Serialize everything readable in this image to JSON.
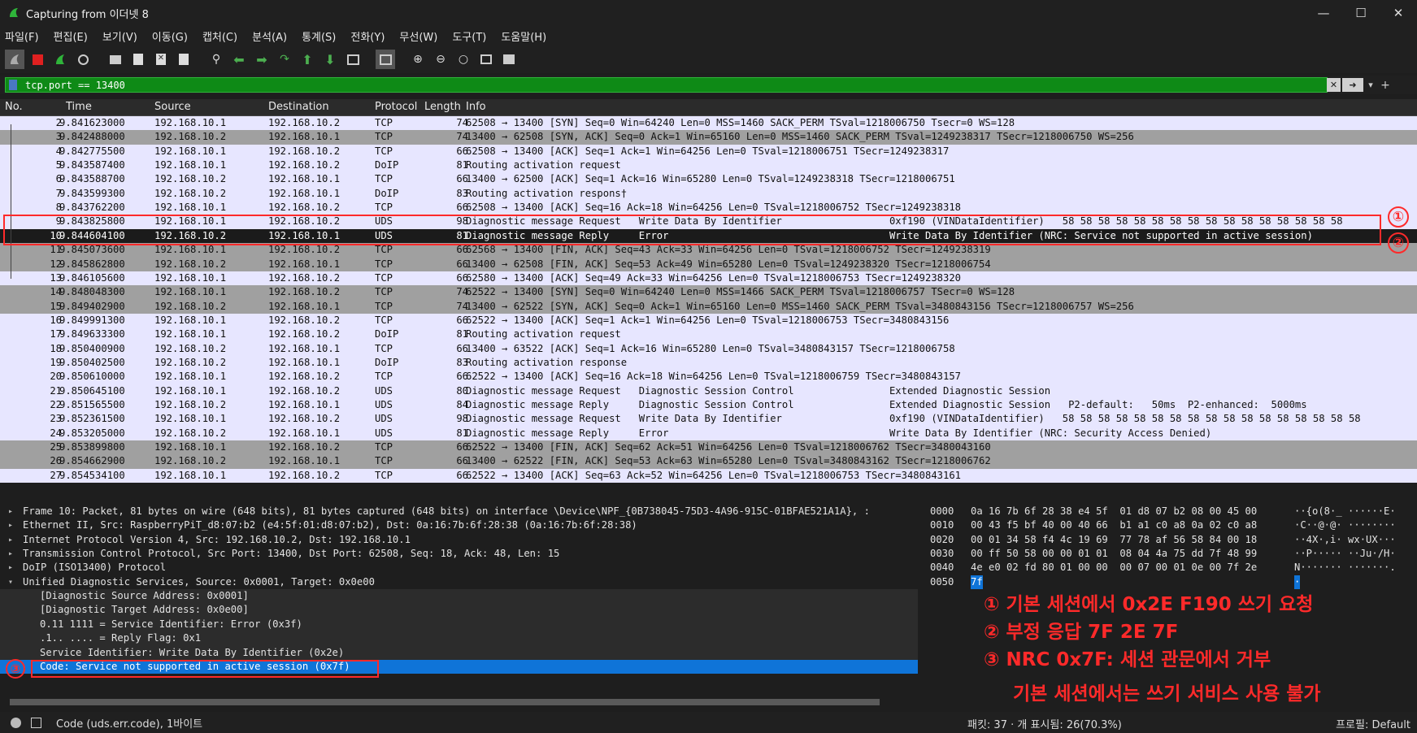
{
  "window": {
    "title": "Capturing from 이더넷 8"
  },
  "menu": [
    "파일(F)",
    "편집(E)",
    "보기(V)",
    "이동(G)",
    "캡처(C)",
    "분석(A)",
    "통계(S)",
    "전화(Y)",
    "무선(W)",
    "도구(T)",
    "도움말(H)"
  ],
  "filter": {
    "value": "tcp.port == 13400"
  },
  "columns": [
    "No.",
    "Time",
    "Source",
    "Destination",
    "Protocol",
    "Length",
    "Info"
  ],
  "packets": [
    {
      "no": "2",
      "time": "9.841623000",
      "src": "192.168.10.1",
      "dst": "192.168.10.2",
      "proto": "TCP",
      "len": "74",
      "info": "62508 → 13400 [SYN] Seq=0 Win=64240 Len=0 MSS=1460 SACK_PERM TSval=1218006750 Tsecr=0 WS=128",
      "style": "tcp-light"
    },
    {
      "no": "3",
      "time": "9.842488000",
      "src": "192.168.10.2",
      "dst": "192.168.10.1",
      "proto": "TCP",
      "len": "74",
      "info": "13400 → 62508 [SYN, ACK] Seq=0 Ack=1 Win=65160 Len=0 MSS=1460 SACK_PERM TSval=1249238317 TSecr=1218006750 WS=256",
      "style": "tcp-gray"
    },
    {
      "no": "4",
      "time": "9.842775500",
      "src": "192.168.10.1",
      "dst": "192.168.10.2",
      "proto": "TCP",
      "len": "66",
      "info": "62508 → 13400 [ACK] Seq=1 Ack=1 Win=64256 Len=0 TSval=1218006751 TSecr=1249238317",
      "style": "tcp-light"
    },
    {
      "no": "5",
      "time": "9.843587400",
      "src": "192.168.10.1",
      "dst": "192.168.10.2",
      "proto": "DoIP",
      "len": "81",
      "info": "Routing activation request",
      "style": "tcp-light"
    },
    {
      "no": "6",
      "time": "9.843588700",
      "src": "192.168.10.2",
      "dst": "192.168.10.1",
      "proto": "TCP",
      "len": "66",
      "info": "13400 → 62500 [ACK] Seq=1 Ack=16 Win=65280 Len=0 TSval=1249238318 TSecr=1218006751",
      "style": "tcp-light"
    },
    {
      "no": "7",
      "time": "9.843599300",
      "src": "192.168.10.2",
      "dst": "192.168.10.1",
      "proto": "DoIP",
      "len": "83",
      "info": "Routing activation respons†",
      "style": "tcp-light"
    },
    {
      "no": "8",
      "time": "9.843762200",
      "src": "192.168.10.1",
      "dst": "192.168.10.2",
      "proto": "TCP",
      "len": "66",
      "info": "62508 → 13400 [ACK] Seq=16 Ack=18 Win=64256 Len=0 TSval=1218006752 TSecr=1249238318",
      "style": "tcp-light"
    },
    {
      "no": "9",
      "time": "9.843825800",
      "src": "192.168.10.1",
      "dst": "192.168.10.2",
      "proto": "UDS",
      "len": "98",
      "info": "Diagnostic message Request   Write Data By Identifier                  0xf190 (VINDataIdentifier)   58 58 58 58 58 58 58 58 58 58 58 58 58 58 58 58",
      "style": "tcp-light"
    },
    {
      "no": "10",
      "time": "9.844604100",
      "src": "192.168.10.2",
      "dst": "192.168.10.1",
      "proto": "UDS",
      "len": "81",
      "info": "Diagnostic message Reply     Error                                     Write Data By Identifier (NRC: Service not supported in active session)",
      "style": "sel"
    },
    {
      "no": "11",
      "time": "9.845073600",
      "src": "192.168.10.1",
      "dst": "192.168.10.2",
      "proto": "TCP",
      "len": "66",
      "info": "62568 → 13400 [FIN, ACK] Seq=43 Ack=33 Win=64256 Len=0 TSval=1218006752 TSecr=1249238319",
      "style": "tcp-gray"
    },
    {
      "no": "12",
      "time": "9.845862800",
      "src": "192.168.10.2",
      "dst": "192.168.10.1",
      "proto": "TCP",
      "len": "66",
      "info": "13400 → 62508 [FIN, ACK] Seq=53 Ack=49 Win=65280 Len=0 TSval=1249238320 TSecr=1218006754",
      "style": "tcp-gray"
    },
    {
      "no": "13",
      "time": "9.846105600",
      "src": "192.168.10.1",
      "dst": "192.168.10.2",
      "proto": "TCP",
      "len": "66",
      "info": "62580 → 13400 [ACK] Seq=49 Ack=33 Win=64256 Len=0 TSval=1218006753 TSecr=1249238320",
      "style": "tcp-light"
    },
    {
      "no": "14",
      "time": "9.848048300",
      "src": "192.168.10.1",
      "dst": "192.168.10.2",
      "proto": "TCP",
      "len": "74",
      "info": "62522 → 13400 [SYN] Seq=0 Win=64240 Len=0 MSS=1466 SACK_PERM TSval=1218006757 TSecr=0 WS=128",
      "style": "tcp-gray"
    },
    {
      "no": "15",
      "time": "9.849402900",
      "src": "192.168.10.2",
      "dst": "192.168.10.1",
      "proto": "TCP",
      "len": "74",
      "info": "13400 → 62522 [SYN, ACK] Seq=0 Ack=1 Win=65160 Len=0 MSS=1460 SACK_PERM TSval=3480843156 TSecr=1218006757 WS=256",
      "style": "tcp-gray"
    },
    {
      "no": "16",
      "time": "9.849991300",
      "src": "192.168.10.1",
      "dst": "192.168.10.2",
      "proto": "TCP",
      "len": "66",
      "info": "62522 → 13400 [ACK] Seq=1 Ack=1 Win=64256 Len=0 TSval=1218006753 TSecr=3480843156",
      "style": "tcp-light"
    },
    {
      "no": "17",
      "time": "9.849633300",
      "src": "192.168.10.1",
      "dst": "192.168.10.2",
      "proto": "DoIP",
      "len": "81",
      "info": "Routing activation request",
      "style": "tcp-light"
    },
    {
      "no": "18",
      "time": "9.850400900",
      "src": "192.168.10.2",
      "dst": "192.168.10.1",
      "proto": "TCP",
      "len": "66",
      "info": "13400 → 63522 [ACK] Seq=1 Ack=16 Win=65280 Len=0 TSval=3480843157 TSecr=1218006758",
      "style": "tcp-light"
    },
    {
      "no": "19",
      "time": "9.850402500",
      "src": "192.168.10.2",
      "dst": "192.168.10.1",
      "proto": "DoIP",
      "len": "83",
      "info": "Routing activation response",
      "style": "tcp-light"
    },
    {
      "no": "20",
      "time": "9.850610000",
      "src": "192.168.10.1",
      "dst": "192.168.10.2",
      "proto": "TCP",
      "len": "66",
      "info": "62522 → 13400 [ACK] Seq=16 Ack=18 Win=64256 Len=0 TSval=1218006759 TSecr=3480843157",
      "style": "tcp-light"
    },
    {
      "no": "21",
      "time": "9.850645100",
      "src": "192.168.10.1",
      "dst": "192.168.10.2",
      "proto": "UDS",
      "len": "80",
      "info": "Diagnostic message Request   Diagnostic Session Control                Extended Diagnostic Session",
      "style": "tcp-light"
    },
    {
      "no": "22",
      "time": "9.851565500",
      "src": "192.168.10.2",
      "dst": "192.168.10.1",
      "proto": "UDS",
      "len": "84",
      "info": "Diagnostic message Reply     Diagnostic Session Control                Extended Diagnostic Session   P2-default:   50ms  P2-enhanced:  5000ms",
      "style": "tcp-light"
    },
    {
      "no": "23",
      "time": "9.852361500",
      "src": "192.168.10.1",
      "dst": "192.168.10.2",
      "proto": "UDS",
      "len": "98",
      "info": "Diagnostic message Request   Write Data By Identifier                  0xf190 (VINDataIdentifier)   58 58 58 58 58 58 58 58 58 58 58 58 58 58 58 58 58",
      "style": "tcp-light"
    },
    {
      "no": "24",
      "time": "9.853205000",
      "src": "192.168.10.2",
      "dst": "192.168.10.1",
      "proto": "UDS",
      "len": "81",
      "info": "Diagnostic message Reply     Error                                     Write Data By Identifier (NRC: Security Access Denied)",
      "style": "tcp-light"
    },
    {
      "no": "25",
      "time": "9.853899800",
      "src": "192.168.10.1",
      "dst": "192.168.10.2",
      "proto": "TCP",
      "len": "66",
      "info": "62522 → 13400 [FIN, ACK] Seq=62 Ack=51 Win=64256 Len=0 TSval=1218006762 TSecr=3480043160",
      "style": "tcp-gray"
    },
    {
      "no": "26",
      "time": "9.854662900",
      "src": "192.168.10.2",
      "dst": "192.168.10.1",
      "proto": "TCP",
      "len": "66",
      "info": "13400 → 62522 [FIN, ACK] Seq=53 Ack=63 Win=65280 Len=0 TSval=3480843162 TSecr=1218006762",
      "style": "tcp-gray"
    },
    {
      "no": "27",
      "time": "9.854534100",
      "src": "192.168.10.1",
      "dst": "192.168.10.2",
      "proto": "TCP",
      "len": "66",
      "info": "62522 → 13400 [ACK] Seq=63 Ack=52 Win=64256 Len=0 TSval=1218006753 TSecr=3480843161",
      "style": "tcp-light"
    }
  ],
  "details": [
    {
      "text": "Frame 10: Packet, 81 bytes on wire (648 bits), 81 bytes captured (648 bits) on interface \\Device\\NPF_{0B738045-75D3-4A96-915C-01BFAE521A1A}, :",
      "indent": 0,
      "arrow": "▸",
      "style": ""
    },
    {
      "text": "Ethernet II, Src: RaspberryPiT_d8:07:b2 (e4:5f:01:d8:07:b2), Dst: 0a:16:7b:6f:28:38 (0a:16:7b:6f:28:38)",
      "indent": 0,
      "arrow": "▸",
      "style": ""
    },
    {
      "text": "Internet Protocol Version 4, Src: 192.168.10.2, Dst: 192.168.10.1",
      "indent": 0,
      "arrow": "▸",
      "style": ""
    },
    {
      "text": "Transmission Control Protocol, Src Port: 13400, Dst Port: 62508, Seq: 18, Ack: 48, Len: 15",
      "indent": 0,
      "arrow": "▸",
      "style": ""
    },
    {
      "text": "DoIP (ISO13400) Protocol",
      "indent": 0,
      "arrow": "▸",
      "style": ""
    },
    {
      "text": "Unified Diagnostic Services, Source: 0x0001, Target: 0x0e00",
      "indent": 0,
      "arrow": "▾",
      "style": ""
    },
    {
      "text": "[Diagnostic Source Address: 0x0001]",
      "indent": 1,
      "arrow": "",
      "style": "sub"
    },
    {
      "text": "[Diagnostic Target Address: 0x0e00]",
      "indent": 1,
      "arrow": "",
      "style": "sub"
    },
    {
      "text": "0.11 1111 = Service Identifier: Error (0x3f)",
      "indent": 1,
      "arrow": "",
      "style": "sub"
    },
    {
      "text": ".1.. .... = Reply Flag: 0x1",
      "indent": 1,
      "arrow": "",
      "style": "sub"
    },
    {
      "text": "Service Identifier: Write Data By Identifier (0x2e)",
      "indent": 1,
      "arrow": "",
      "style": "sub"
    },
    {
      "text": "Code: Service not supported in active session (0x7f)",
      "indent": 1,
      "arrow": "",
      "style": "sel"
    }
  ],
  "hex": [
    {
      "off": "0000",
      "bytes": "0a 16 7b 6f 28 38 e4 5f  01 d8 07 b2 08 00 45 00",
      "ascii": "··{o(8·_ ······E·"
    },
    {
      "off": "0010",
      "bytes": "00 43 f5 bf 40 00 40 66  b1 a1 c0 a8 0a 02 c0 a8",
      "ascii": "·C··@·@· ········"
    },
    {
      "off": "0020",
      "bytes": "00 01 34 58 f4 4c 19 69  77 78 af 56 58 84 00 18",
      "ascii": "··4X·,i· wx·UX···"
    },
    {
      "off": "0030",
      "bytes": "00 ff 50 58 00 00 01 01  08 04 4a 75 dd 7f 48 99",
      "ascii": "··P····· ··Ju·/H·"
    },
    {
      "off": "0040",
      "bytes": "4e e0 02 fd 80 01 00 00  00 07 00 01 0e 00 7f 2e",
      "ascii": "N······· ·······."
    },
    {
      "off": "0050",
      "bytes": "7f",
      "ascii": "·"
    }
  ],
  "annotations": {
    "n1": "①",
    "n2": "②",
    "n3": "③",
    "lines": [
      "①  기본 세션에서 0x2E F190 쓰기 요청",
      "②  부정 응답 7F 2E 7F",
      "③  NRC 0x7F: 세션 관문에서 거부",
      "기본 세션에서는 쓰기 서비스 사용 불가"
    ]
  },
  "status": {
    "field": "Code (uds.err.code), 1바이트",
    "packets": "패킷: 37 · 개 표시됨: 26(70.3%)",
    "profile": "프로필: Default"
  },
  "colors": {
    "accent": "#0f74d8",
    "filter_ok": "#0e8a16",
    "annot": "#ff2a2a"
  }
}
